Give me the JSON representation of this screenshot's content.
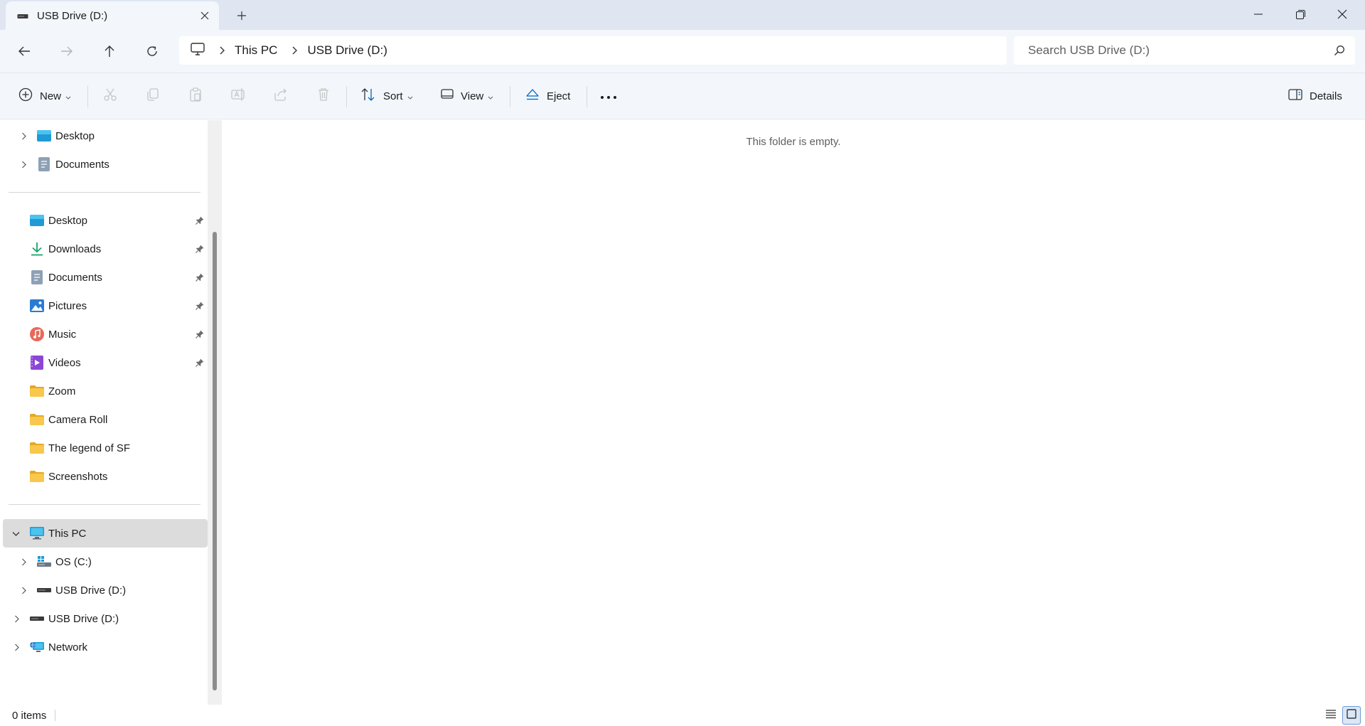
{
  "window": {
    "tab_title": "USB Drive (D:)",
    "controls": [
      "minimize",
      "maximize",
      "close"
    ]
  },
  "address": {
    "breadcrumb": [
      "This PC",
      "USB Drive (D:)"
    ],
    "search_placeholder": "Search USB Drive (D:)"
  },
  "toolbar": {
    "new_label": "New",
    "sort_label": "Sort",
    "view_label": "View",
    "eject_label": "Eject",
    "details_label": "Details"
  },
  "sidebar": {
    "top_items": [
      {
        "label": "Desktop",
        "icon": "desktop-icon"
      },
      {
        "label": "Documents",
        "icon": "documents-icon"
      }
    ],
    "quick_access": [
      {
        "label": "Desktop",
        "icon": "desktop-icon",
        "pinned": true
      },
      {
        "label": "Downloads",
        "icon": "download-icon",
        "pinned": true
      },
      {
        "label": "Documents",
        "icon": "documents-icon",
        "pinned": true
      },
      {
        "label": "Pictures",
        "icon": "pictures-icon",
        "pinned": true
      },
      {
        "label": "Music",
        "icon": "music-icon",
        "pinned": true
      },
      {
        "label": "Videos",
        "icon": "videos-icon",
        "pinned": true
      },
      {
        "label": "Zoom",
        "icon": "folder-icon",
        "pinned": false
      },
      {
        "label": "Camera Roll",
        "icon": "folder-icon",
        "pinned": false
      },
      {
        "label": "The legend of SF",
        "icon": "folder-icon",
        "pinned": false
      },
      {
        "label": "Screenshots",
        "icon": "folder-icon",
        "pinned": false
      }
    ],
    "this_pc": {
      "label": "This PC",
      "icon": "computer-icon",
      "expanded": true,
      "selected": true
    },
    "this_pc_children": [
      {
        "label": "OS (C:)",
        "icon": "os-drive-icon"
      },
      {
        "label": "USB Drive (D:)",
        "icon": "usb-drive-icon"
      }
    ],
    "usb_drive": {
      "label": "USB Drive (D:)",
      "icon": "usb-drive-icon"
    },
    "network": {
      "label": "Network",
      "icon": "network-icon"
    }
  },
  "content": {
    "empty_message": "This folder is empty."
  },
  "status": {
    "item_count": "0 items"
  },
  "colors": {
    "chrome_bg": "#f3f6fb",
    "titlebar_bg": "#dfe6f2",
    "accent": "#0067c0",
    "selected_bg": "#dcdcdc",
    "folder": "#f8c74b"
  }
}
